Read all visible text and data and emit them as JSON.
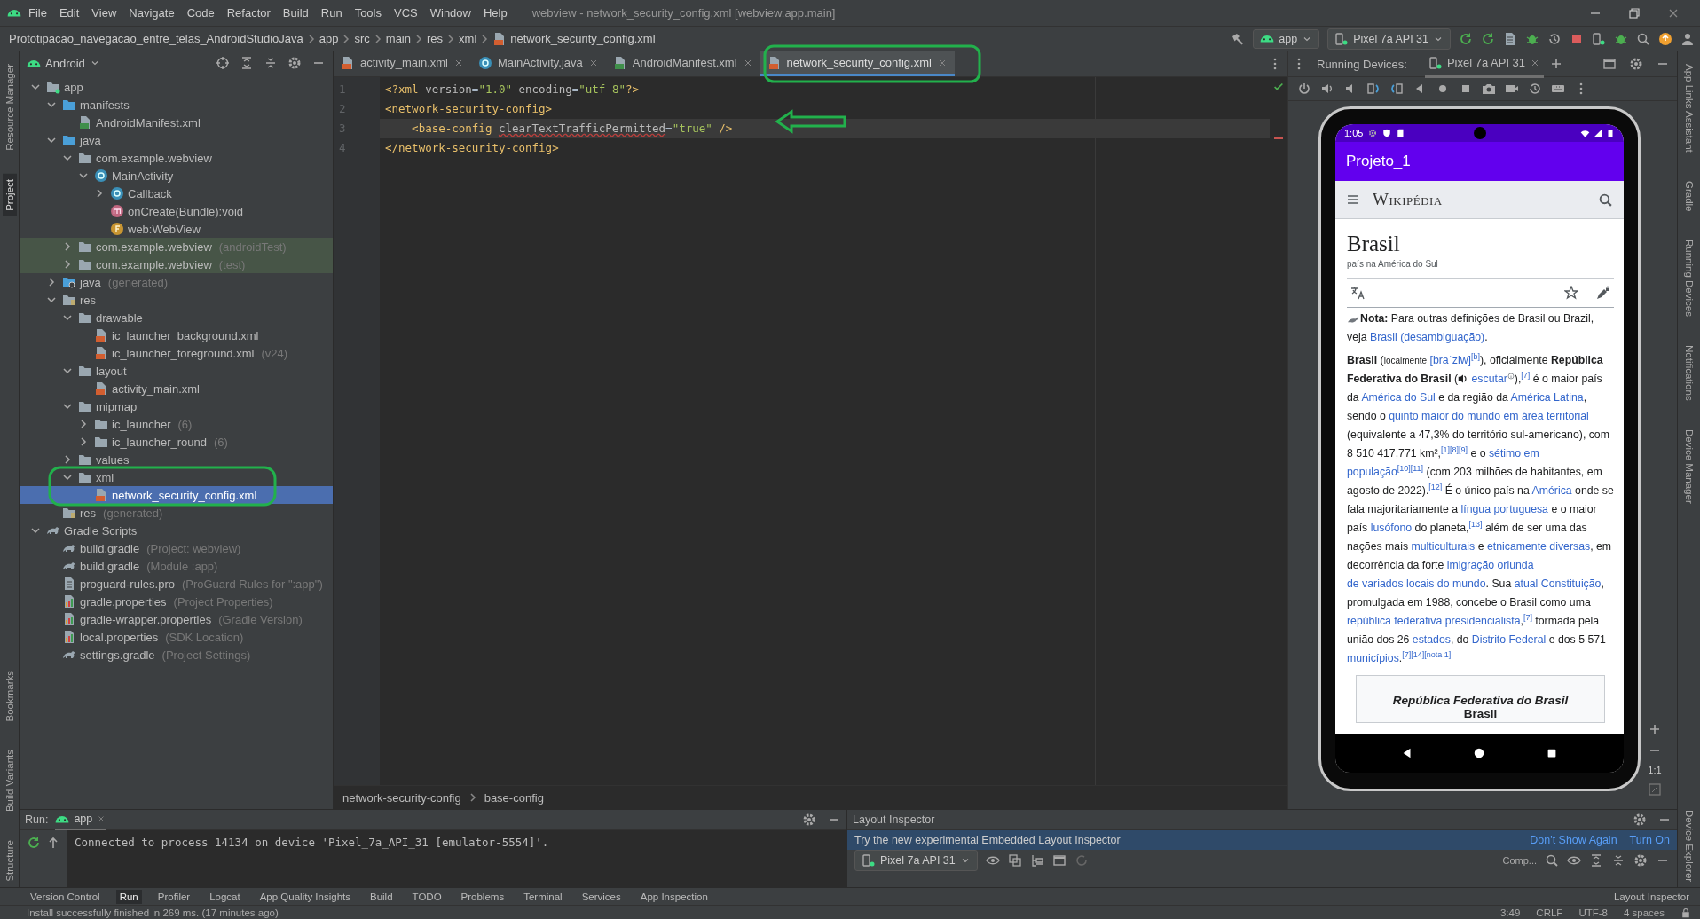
{
  "menu_bar": {
    "items": [
      "File",
      "Edit",
      "View",
      "Navigate",
      "Code",
      "Refactor",
      "Build",
      "Run",
      "Tools",
      "VCS",
      "Window",
      "Help"
    ],
    "title": "webview - network_security_config.xml [webview.app.main]"
  },
  "navigation_bar": {
    "breadcrumb": [
      "Prototipacao_navegacao_entre_telas_AndroidStudioJava",
      "app",
      "src",
      "main",
      "res",
      "xml",
      "network_security_config.xml"
    ],
    "run_configuration": "app",
    "device": "Pixel 7a API 31"
  },
  "left_stripe": [
    {
      "label": "Resource Manager",
      "selected": false
    },
    {
      "label": "Project",
      "selected": true
    },
    {
      "label": "Bookmarks",
      "selected": false
    },
    {
      "label": "Build Variants",
      "selected": false
    },
    {
      "label": "Structure",
      "selected": false
    }
  ],
  "right_stripe": [
    {
      "label": "App Links Assistant",
      "selected": false
    },
    {
      "label": "Gradle",
      "selected": false
    },
    {
      "label": "Running Devices",
      "selected": false
    },
    {
      "label": "Notifications",
      "selected": false
    },
    {
      "label": "Device Manager",
      "selected": false
    },
    {
      "label": "Device Explorer",
      "selected": false
    }
  ],
  "project_panel": {
    "view": "Android",
    "tree": [
      {
        "label": "app",
        "kind": "module",
        "expanded": true,
        "selected": false,
        "children": [
          {
            "label": "manifests",
            "kind": "source-folder",
            "expanded": true,
            "selected": false,
            "children": [
              {
                "label": "AndroidManifest.xml",
                "kind": "manifest",
                "selected": false
              }
            ]
          },
          {
            "label": "java",
            "kind": "source-folder",
            "expanded": true,
            "selected": false,
            "children": [
              {
                "label": "com.example.webview",
                "kind": "package",
                "expanded": true,
                "selected": false,
                "children": [
                  {
                    "label": "MainActivity",
                    "kind": "class",
                    "expanded": true,
                    "selected": false,
                    "children": [
                      {
                        "label": "Callback",
                        "kind": "class",
                        "expanded": false,
                        "selected": false
                      },
                      {
                        "label": "onCreate(Bundle):void",
                        "kind": "method",
                        "selected": false
                      },
                      {
                        "label": "web:WebView",
                        "kind": "field",
                        "selected": false
                      }
                    ]
                  }
                ]
              },
              {
                "label": "com.example.webview",
                "hint": "(androidTest)",
                "kind": "package",
                "expanded": false,
                "selected": false,
                "test": true
              },
              {
                "label": "com.example.webview",
                "hint": "(test)",
                "kind": "package",
                "expanded": false,
                "selected": false,
                "test": true
              }
            ]
          },
          {
            "label": "java",
            "hint": "(generated)",
            "kind": "generated-folder",
            "expanded": false,
            "selected": false
          },
          {
            "label": "res",
            "kind": "res-folder",
            "expanded": true,
            "selected": false,
            "children": [
              {
                "label": "drawable",
                "kind": "package",
                "expanded": true,
                "selected": false,
                "children": [
                  {
                    "label": "ic_launcher_background.xml",
                    "kind": "xml",
                    "selected": false
                  },
                  {
                    "label": "ic_launcher_foreground.xml",
                    "hint": "(v24)",
                    "kind": "xml",
                    "selected": false
                  }
                ]
              },
              {
                "label": "layout",
                "kind": "package",
                "expanded": true,
                "selected": false,
                "children": [
                  {
                    "label": "activity_main.xml",
                    "kind": "xml",
                    "selected": false
                  }
                ]
              },
              {
                "label": "mipmap",
                "kind": "package",
                "expanded": true,
                "selected": false,
                "children": [
                  {
                    "label": "ic_launcher",
                    "hint": "(6)",
                    "kind": "package",
                    "expanded": false,
                    "selected": false
                  },
                  {
                    "label": "ic_launcher_round",
                    "hint": "(6)",
                    "kind": "package",
                    "expanded": false,
                    "selected": false
                  }
                ]
              },
              {
                "label": "values",
                "kind": "package",
                "expanded": false,
                "selected": false
              },
              {
                "label": "xml",
                "kind": "package",
                "expanded": true,
                "selected": false,
                "children": [
                  {
                    "label": "network_security_config.xml",
                    "kind": "xml",
                    "selected": true
                  }
                ]
              }
            ]
          },
          {
            "label": "res",
            "hint": "(generated)",
            "kind": "res-folder",
            "selected": false
          }
        ]
      },
      {
        "label": "Gradle Scripts",
        "kind": "gradle",
        "expanded": true,
        "selected": false,
        "children": [
          {
            "label": "build.gradle",
            "hint": "(Project: webview)",
            "kind": "gradle",
            "selected": false
          },
          {
            "label": "build.gradle",
            "hint": "(Module :app)",
            "kind": "gradle",
            "selected": false
          },
          {
            "label": "proguard-rules.pro",
            "hint": "(ProGuard Rules for \":app\")",
            "kind": "text-file",
            "selected": false
          },
          {
            "label": "gradle.properties",
            "hint": "(Project Properties)",
            "kind": "properties",
            "selected": false
          },
          {
            "label": "gradle-wrapper.properties",
            "hint": "(Gradle Version)",
            "kind": "properties",
            "selected": false
          },
          {
            "label": "local.properties",
            "hint": "(SDK Location)",
            "kind": "properties",
            "selected": false
          },
          {
            "label": "settings.gradle",
            "hint": "(Project Settings)",
            "kind": "gradle",
            "selected": false
          }
        ]
      }
    ]
  },
  "editor": {
    "tabs": [
      {
        "label": "activity_main.xml",
        "kind": "xml",
        "selected": false
      },
      {
        "label": "MainActivity.java",
        "kind": "class",
        "selected": false
      },
      {
        "label": "AndroidManifest.xml",
        "kind": "manifest",
        "selected": false
      },
      {
        "label": "network_security_config.xml",
        "kind": "xml",
        "selected": true
      }
    ],
    "lines": [
      {
        "number": "1",
        "current": false,
        "tokens": [
          {
            "kind": "tag",
            "text": "<?xml "
          },
          {
            "kind": "attr",
            "text": "version"
          },
          {
            "kind": "plain",
            "text": "="
          },
          {
            "kind": "value",
            "text": "\"1.0\" "
          },
          {
            "kind": "attr",
            "text": "encoding"
          },
          {
            "kind": "plain",
            "text": "="
          },
          {
            "kind": "value",
            "text": "\"utf-8\""
          },
          {
            "kind": "tag",
            "text": "?>"
          }
        ]
      },
      {
        "number": "2",
        "current": false,
        "tokens": [
          {
            "kind": "tag",
            "text": "<network-security-config>"
          }
        ]
      },
      {
        "number": "3",
        "current": true,
        "tokens": [
          {
            "kind": "tag",
            "text": "    <base-config "
          },
          {
            "kind": "attr-warning",
            "text": "clearTextTrafficPermitted"
          },
          {
            "kind": "plain",
            "text": "="
          },
          {
            "kind": "value",
            "text": "\"true\""
          },
          {
            "kind": "tag",
            "text": " />"
          }
        ]
      },
      {
        "number": "4",
        "current": false,
        "tokens": [
          {
            "kind": "tag",
            "text": "</network-security-config>"
          }
        ]
      }
    ],
    "breadcrumb": [
      "network-security-config",
      "base-config"
    ]
  },
  "running_devices": {
    "label": "Running Devices:",
    "tab": "Pixel 7a API 31",
    "phone": {
      "time": "1:05",
      "app_title": "Projeto_1",
      "site": "Wikipédia",
      "article_title": "Brasil",
      "article_subtitle": "país na América do Sul",
      "hatnote": [
        {
          "kind": "hatnote-icon"
        },
        {
          "kind": "bold",
          "text": "Nota:"
        },
        {
          "kind": "text",
          "text": " Para outras definições de Brasil ou Brazil, veja "
        },
        {
          "kind": "link",
          "text": "Brasil (desambiguação)"
        },
        {
          "kind": "text",
          "text": "."
        }
      ],
      "paragraph": [
        {
          "kind": "bold",
          "text": "Brasil"
        },
        {
          "kind": "text",
          "text": " ("
        },
        {
          "kind": "small",
          "text": "localmente"
        },
        {
          "kind": "space"
        },
        {
          "kind": "link",
          "text": "[braˈziw]"
        },
        {
          "kind": "ref",
          "text": "[b]"
        },
        {
          "kind": "text",
          "text": "), oficialmente "
        },
        {
          "kind": "bold",
          "text": "República Federativa do Brasil"
        },
        {
          "kind": "text",
          "text": " ("
        },
        {
          "kind": "audio-icon"
        },
        {
          "kind": "space"
        },
        {
          "kind": "link",
          "text": "escutar"
        },
        {
          "kind": "info-icon"
        },
        {
          "kind": "text",
          "text": "),"
        },
        {
          "kind": "ref",
          "text": "[7]"
        },
        {
          "kind": "text",
          "text": " é o maior país da "
        },
        {
          "kind": "link",
          "text": "América do Sul"
        },
        {
          "kind": "text",
          "text": " e da região da "
        },
        {
          "kind": "link",
          "text": "América Latina"
        },
        {
          "kind": "text",
          "text": ", sendo o "
        },
        {
          "kind": "link",
          "text": "quinto maior do mundo em área territorial"
        },
        {
          "kind": "text",
          "text": " (equivalente a 47,3% do território sul-americano), com 8 510 417,771 km²,"
        },
        {
          "kind": "ref",
          "text": "[1][8][9]"
        },
        {
          "kind": "text",
          "text": " e o "
        },
        {
          "kind": "link",
          "text": "sétimo em"
        },
        {
          "kind": "space"
        },
        {
          "kind": "link",
          "text": "população"
        },
        {
          "kind": "ref",
          "text": "[10][11]"
        },
        {
          "kind": "text",
          "text": " (com 203 milhões de habitantes, em agosto de 2022)."
        },
        {
          "kind": "ref",
          "text": "[12]"
        },
        {
          "kind": "text",
          "text": " É o único país na "
        },
        {
          "kind": "link",
          "text": "América"
        },
        {
          "kind": "text",
          "text": " onde se fala majoritariamente a "
        },
        {
          "kind": "link",
          "text": "língua portuguesa"
        },
        {
          "kind": "text",
          "text": " e o maior país "
        },
        {
          "kind": "link",
          "text": "lusófono"
        },
        {
          "kind": "text",
          "text": " do planeta,"
        },
        {
          "kind": "ref",
          "text": "[13]"
        },
        {
          "kind": "text",
          "text": " além de ser uma das nações mais "
        },
        {
          "kind": "link",
          "text": "multiculturais"
        },
        {
          "kind": "text",
          "text": " e "
        },
        {
          "kind": "link",
          "text": "etnicamente"
        },
        {
          "kind": "space"
        },
        {
          "kind": "link",
          "text": "diversas"
        },
        {
          "kind": "text",
          "text": ", em decorrência da forte "
        },
        {
          "kind": "link",
          "text": "imigração oriunda"
        },
        {
          "kind": "space"
        },
        {
          "kind": "link",
          "text": "de variados locais do mundo"
        },
        {
          "kind": "text",
          "text": ". Sua "
        },
        {
          "kind": "link",
          "text": "atual Constituição"
        },
        {
          "kind": "text",
          "text": ", promulgada em 1988, concebe o Brasil como uma "
        },
        {
          "kind": "link",
          "text": "república federativa presidencialista"
        },
        {
          "kind": "text",
          "text": ","
        },
        {
          "kind": "ref",
          "text": "[7]"
        },
        {
          "kind": "text",
          "text": " formada pela união dos 26 "
        },
        {
          "kind": "link",
          "text": "estados"
        },
        {
          "kind": "text",
          "text": ", do "
        },
        {
          "kind": "link",
          "text": "Distrito Federal"
        },
        {
          "kind": "text",
          "text": " e dos 5 571 "
        },
        {
          "kind": "link",
          "text": "municípios"
        },
        {
          "kind": "text",
          "text": "."
        },
        {
          "kind": "ref",
          "text": "[7][14][nota 1]"
        }
      ],
      "infobox_title": "República Federativa do Brasil",
      "infobox_subtitle": "Brasil"
    },
    "zoom_ratio": "1:1"
  },
  "run_panel": {
    "label": "Run:",
    "tab": "app",
    "output": "Connected to process 14134 on device 'Pixel_7a_API_31 [emulator-5554]'."
  },
  "layout_inspector": {
    "title": "Layout Inspector",
    "banner": "Try the new experimental Embedded Layout Inspector",
    "actions": [
      "Don't Show Again",
      "Turn On"
    ],
    "device": "Pixel 7a API 31",
    "component_tree": "Comp..."
  },
  "tool_windows": [
    {
      "label": "Version Control",
      "selected": false
    },
    {
      "label": "Run",
      "selected": true
    },
    {
      "label": "Profiler",
      "selected": false
    },
    {
      "label": "Logcat",
      "selected": false
    },
    {
      "label": "App Quality Insights",
      "selected": false
    },
    {
      "label": "Build",
      "selected": false
    },
    {
      "label": "TODO",
      "selected": false
    },
    {
      "label": "Problems",
      "selected": false
    },
    {
      "label": "Terminal",
      "selected": false
    },
    {
      "label": "Services",
      "selected": false
    },
    {
      "label": "App Inspection",
      "selected": false
    }
  ],
  "tool_windows_right": [
    {
      "label": "Layout Inspector",
      "selected": false
    }
  ],
  "status_bar": {
    "message": "Install successfully finished in 269 ms. (17 minutes ago)",
    "items": [
      "3:49",
      "CRLF",
      "UTF-8",
      "4 spaces"
    ]
  }
}
